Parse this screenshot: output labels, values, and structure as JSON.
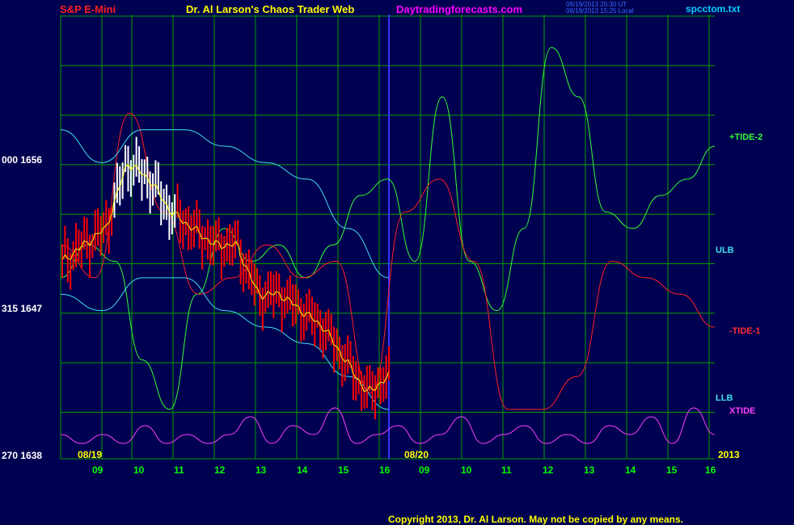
{
  "header": {
    "symbol": "S&P E-Mini",
    "title": "Dr. Al Larson's Chaos Trader Web",
    "site": "Daytradingforecasts.com",
    "stamp1": "08/19/2013 20:30 UT",
    "stamp2": "08/19/2013 15:25 Local",
    "file": "spcctom.txt"
  },
  "footer": {
    "copyright": "Copyright 2013, Dr. Al Larson. May not be copied by any means."
  },
  "colors": {
    "background": "#000050",
    "grid": "#00a000",
    "divider": "#3333ff",
    "tide2": "#33ff33",
    "tide1": "#ff2020",
    "bands": "#40e0f0",
    "xtide": "#ff40ff",
    "price_up": "#ffffff",
    "price_down": "#ff0000",
    "moving_avg": "#ffff00",
    "symbol_text": "#ff0000",
    "title_text": "#ffff00",
    "site_text": "#ff00ff",
    "file_text": "#00d0ff"
  },
  "chart_data": {
    "type": "line",
    "title": "S&P E-Mini",
    "y_axis": {
      "labels": [
        "000 1656",
        "315 1647",
        "270 1638"
      ],
      "ylim": [
        1638,
        1665
      ]
    },
    "x_axis": {
      "hour_labels": [
        "09",
        "10",
        "11",
        "12",
        "13",
        "14",
        "15",
        "16",
        "09",
        "10",
        "11",
        "12",
        "13",
        "14",
        "15",
        "16"
      ],
      "date_labels": [
        "08/19",
        "08/20"
      ],
      "year_label": "2013"
    },
    "series": [
      {
        "name": "+TIDE-2",
        "color": "#33ff33",
        "values": [
          1649,
          1651,
          1650,
          1644,
          1641,
          1648,
          1652,
          1650,
          1651,
          1649,
          1651,
          1654,
          1655,
          1650,
          1660,
          1650,
          1647,
          1652,
          1663,
          1660,
          1653,
          1652,
          1654,
          1655,
          1657
        ]
      },
      {
        "name": "-TIDE-1",
        "color": "#ff2020",
        "values": [
          1651,
          1649,
          1659,
          1653,
          1648,
          1649,
          1651,
          1649,
          1650,
          1642,
          1653,
          1655,
          1650,
          1641,
          1641,
          1643,
          1650,
          1649,
          1648,
          1646
        ]
      },
      {
        "name": "ULB",
        "color": "#40e0f0",
        "values": [
          1658,
          1656,
          1658,
          1658,
          1657,
          1656,
          1655,
          1652,
          1649
        ]
      },
      {
        "name": "LLB",
        "color": "#40e0f0",
        "values": [
          1648,
          1647,
          1649,
          1649,
          1647,
          1646,
          1645,
          1643,
          1641
        ]
      },
      {
        "name": "XTIDE",
        "color": "#ff40ff",
        "values": [
          2,
          1,
          2,
          1,
          3,
          1,
          2,
          1,
          2,
          4,
          1,
          3,
          2,
          5,
          1,
          2,
          3,
          1,
          2,
          4,
          1,
          2,
          3,
          1,
          2,
          1,
          3,
          2,
          4,
          1,
          5,
          2
        ]
      }
    ],
    "price": {
      "x": [
        "09:00",
        "09:30",
        "10:00",
        "10:30",
        "11:00",
        "11:30",
        "12:00",
        "12:30",
        "13:00",
        "13:30",
        "14:00",
        "14:30",
        "15:00",
        "15:30",
        "16:00",
        "16:10"
      ],
      "values": [
        1650,
        1651,
        1652,
        1656,
        1655,
        1653,
        1652,
        1651,
        1651,
        1648,
        1648,
        1647,
        1646,
        1644,
        1642,
        1643
      ]
    },
    "right_labels": [
      "+TIDE-2",
      "ULB",
      "-TIDE-1",
      "LLB",
      "XTIDE"
    ],
    "grid": true
  }
}
